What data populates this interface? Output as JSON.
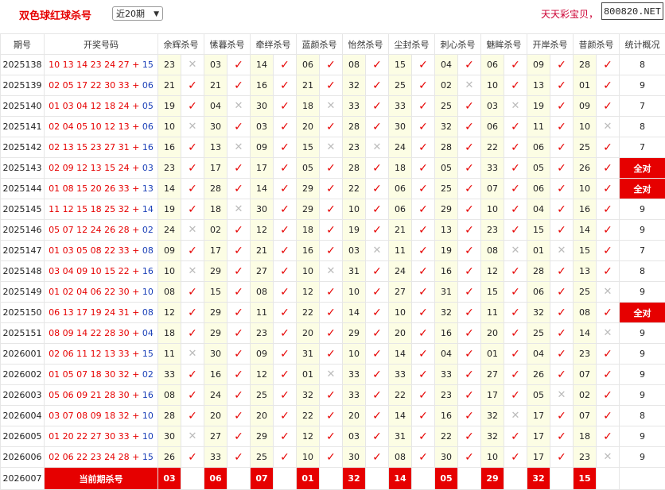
{
  "header": {
    "title": "双色球红球杀号",
    "period_select": "近20期",
    "promo": "天天彩宝贝，",
    "site_badge": "800820.NET"
  },
  "columns": [
    "期号",
    "开奖号码",
    "余辉杀号",
    "愫暮杀号",
    "牵绊杀号",
    "蓝颜杀号",
    "怡然杀号",
    "尘封杀号",
    "刺心杀号",
    "魅眸杀号",
    "开岸杀号",
    "昔颜杀号",
    "统计概况"
  ],
  "symbols": {
    "check": "✓",
    "cross": "✕"
  },
  "rows": [
    {
      "period": "2025138",
      "red": "10 13 14 23 24 27",
      "plus": "+",
      "blue": "15",
      "kills": [
        [
          "23",
          "x"
        ],
        [
          "03",
          "v"
        ],
        [
          "14",
          "v"
        ],
        [
          "06",
          "v"
        ],
        [
          "08",
          "v"
        ],
        [
          "15",
          "v"
        ],
        [
          "04",
          "v"
        ],
        [
          "06",
          "v"
        ],
        [
          "09",
          "v"
        ],
        [
          "28",
          "v"
        ]
      ],
      "stat": "8",
      "full": false
    },
    {
      "period": "2025139",
      "red": "02 05 17 22 30 33",
      "plus": "+",
      "blue": "06",
      "kills": [
        [
          "21",
          "v"
        ],
        [
          "21",
          "v"
        ],
        [
          "16",
          "v"
        ],
        [
          "21",
          "v"
        ],
        [
          "32",
          "v"
        ],
        [
          "25",
          "v"
        ],
        [
          "02",
          "x"
        ],
        [
          "10",
          "v"
        ],
        [
          "13",
          "v"
        ],
        [
          "01",
          "v"
        ]
      ],
      "stat": "9",
      "full": false
    },
    {
      "period": "2025140",
      "red": "01 03 04 12 18 24",
      "plus": "+",
      "blue": "05",
      "kills": [
        [
          "19",
          "v"
        ],
        [
          "04",
          "x"
        ],
        [
          "30",
          "v"
        ],
        [
          "18",
          "x"
        ],
        [
          "33",
          "v"
        ],
        [
          "33",
          "v"
        ],
        [
          "25",
          "v"
        ],
        [
          "03",
          "x"
        ],
        [
          "19",
          "v"
        ],
        [
          "09",
          "v"
        ]
      ],
      "stat": "7",
      "full": false
    },
    {
      "period": "2025141",
      "red": "02 04 05 10 12 13",
      "plus": "+",
      "blue": "06",
      "kills": [
        [
          "10",
          "x"
        ],
        [
          "30",
          "v"
        ],
        [
          "03",
          "v"
        ],
        [
          "20",
          "v"
        ],
        [
          "28",
          "v"
        ],
        [
          "30",
          "v"
        ],
        [
          "32",
          "v"
        ],
        [
          "06",
          "v"
        ],
        [
          "11",
          "v"
        ],
        [
          "10",
          "x"
        ]
      ],
      "stat": "8",
      "full": false
    },
    {
      "period": "2025142",
      "red": "02 13 15 23 27 31",
      "plus": "+",
      "blue": "16",
      "kills": [
        [
          "16",
          "v"
        ],
        [
          "13",
          "x"
        ],
        [
          "09",
          "v"
        ],
        [
          "15",
          "x"
        ],
        [
          "23",
          "x"
        ],
        [
          "24",
          "v"
        ],
        [
          "28",
          "v"
        ],
        [
          "22",
          "v"
        ],
        [
          "06",
          "v"
        ],
        [
          "25",
          "v"
        ]
      ],
      "stat": "7",
      "full": false
    },
    {
      "period": "2025143",
      "red": "02 09 12 13 15 24",
      "plus": "+",
      "blue": "03",
      "kills": [
        [
          "23",
          "v"
        ],
        [
          "17",
          "v"
        ],
        [
          "17",
          "v"
        ],
        [
          "05",
          "v"
        ],
        [
          "28",
          "v"
        ],
        [
          "18",
          "v"
        ],
        [
          "05",
          "v"
        ],
        [
          "33",
          "v"
        ],
        [
          "05",
          "v"
        ],
        [
          "26",
          "v"
        ]
      ],
      "stat": "全对",
      "full": true
    },
    {
      "period": "2025144",
      "red": "01 08 15 20 26 33",
      "plus": "+",
      "blue": "13",
      "kills": [
        [
          "14",
          "v"
        ],
        [
          "28",
          "v"
        ],
        [
          "14",
          "v"
        ],
        [
          "29",
          "v"
        ],
        [
          "22",
          "v"
        ],
        [
          "06",
          "v"
        ],
        [
          "25",
          "v"
        ],
        [
          "07",
          "v"
        ],
        [
          "06",
          "v"
        ],
        [
          "10",
          "v"
        ]
      ],
      "stat": "全对",
      "full": true
    },
    {
      "period": "2025145",
      "red": "11 12 15 18 25 32",
      "plus": "+",
      "blue": "14",
      "kills": [
        [
          "19",
          "v"
        ],
        [
          "18",
          "x"
        ],
        [
          "30",
          "v"
        ],
        [
          "29",
          "v"
        ],
        [
          "10",
          "v"
        ],
        [
          "06",
          "v"
        ],
        [
          "29",
          "v"
        ],
        [
          "10",
          "v"
        ],
        [
          "04",
          "v"
        ],
        [
          "16",
          "v"
        ]
      ],
      "stat": "9",
      "full": false
    },
    {
      "period": "2025146",
      "red": "05 07 12 24 26 28",
      "plus": "+",
      "blue": "02",
      "kills": [
        [
          "24",
          "x"
        ],
        [
          "02",
          "v"
        ],
        [
          "12",
          "v"
        ],
        [
          "18",
          "v"
        ],
        [
          "19",
          "v"
        ],
        [
          "21",
          "v"
        ],
        [
          "13",
          "v"
        ],
        [
          "23",
          "v"
        ],
        [
          "15",
          "v"
        ],
        [
          "14",
          "v"
        ]
      ],
      "stat": "9",
      "full": false
    },
    {
      "period": "2025147",
      "red": "01 03 05 08 22 33",
      "plus": "+",
      "blue": "08",
      "kills": [
        [
          "09",
          "v"
        ],
        [
          "17",
          "v"
        ],
        [
          "21",
          "v"
        ],
        [
          "16",
          "v"
        ],
        [
          "03",
          "x"
        ],
        [
          "11",
          "v"
        ],
        [
          "19",
          "v"
        ],
        [
          "08",
          "x"
        ],
        [
          "01",
          "x"
        ],
        [
          "15",
          "v"
        ]
      ],
      "stat": "7",
      "full": false
    },
    {
      "period": "2025148",
      "red": "03 04 09 10 15 22",
      "plus": "+",
      "blue": "16",
      "kills": [
        [
          "10",
          "x"
        ],
        [
          "29",
          "v"
        ],
        [
          "27",
          "v"
        ],
        [
          "10",
          "x"
        ],
        [
          "31",
          "v"
        ],
        [
          "24",
          "v"
        ],
        [
          "16",
          "v"
        ],
        [
          "12",
          "v"
        ],
        [
          "28",
          "v"
        ],
        [
          "13",
          "v"
        ]
      ],
      "stat": "8",
      "full": false
    },
    {
      "period": "2025149",
      "red": "01 02 04 06 22 30",
      "plus": "+",
      "blue": "10",
      "kills": [
        [
          "08",
          "v"
        ],
        [
          "15",
          "v"
        ],
        [
          "08",
          "v"
        ],
        [
          "12",
          "v"
        ],
        [
          "10",
          "v"
        ],
        [
          "27",
          "v"
        ],
        [
          "31",
          "v"
        ],
        [
          "15",
          "v"
        ],
        [
          "06",
          "v"
        ],
        [
          "25",
          "x"
        ]
      ],
      "stat": "9",
      "full": false
    },
    {
      "period": "2025150",
      "red": "06 13 17 19 24 31",
      "plus": "+",
      "blue": "08",
      "kills": [
        [
          "12",
          "v"
        ],
        [
          "29",
          "v"
        ],
        [
          "11",
          "v"
        ],
        [
          "22",
          "v"
        ],
        [
          "14",
          "v"
        ],
        [
          "10",
          "v"
        ],
        [
          "32",
          "v"
        ],
        [
          "11",
          "v"
        ],
        [
          "32",
          "v"
        ],
        [
          "08",
          "v"
        ]
      ],
      "stat": "全对",
      "full": true
    },
    {
      "period": "2025151",
      "red": "08 09 14 22 28 30",
      "plus": "+",
      "blue": "04",
      "kills": [
        [
          "18",
          "v"
        ],
        [
          "29",
          "v"
        ],
        [
          "23",
          "v"
        ],
        [
          "20",
          "v"
        ],
        [
          "29",
          "v"
        ],
        [
          "20",
          "v"
        ],
        [
          "16",
          "v"
        ],
        [
          "20",
          "v"
        ],
        [
          "25",
          "v"
        ],
        [
          "14",
          "x"
        ]
      ],
      "stat": "9",
      "full": false
    },
    {
      "period": "2026001",
      "red": "02 06 11 12 13 33",
      "plus": "+",
      "blue": "15",
      "kills": [
        [
          "11",
          "x"
        ],
        [
          "30",
          "v"
        ],
        [
          "09",
          "v"
        ],
        [
          "31",
          "v"
        ],
        [
          "10",
          "v"
        ],
        [
          "14",
          "v"
        ],
        [
          "04",
          "v"
        ],
        [
          "01",
          "v"
        ],
        [
          "04",
          "v"
        ],
        [
          "23",
          "v"
        ]
      ],
      "stat": "9",
      "full": false
    },
    {
      "period": "2026002",
      "red": "01 05 07 18 30 32",
      "plus": "+",
      "blue": "02",
      "kills": [
        [
          "33",
          "v"
        ],
        [
          "16",
          "v"
        ],
        [
          "12",
          "v"
        ],
        [
          "01",
          "x"
        ],
        [
          "33",
          "v"
        ],
        [
          "33",
          "v"
        ],
        [
          "33",
          "v"
        ],
        [
          "27",
          "v"
        ],
        [
          "26",
          "v"
        ],
        [
          "07",
          "v"
        ]
      ],
      "stat": "9",
      "full": false
    },
    {
      "period": "2026003",
      "red": "05 06 09 21 28 30",
      "plus": "+",
      "blue": "16",
      "kills": [
        [
          "08",
          "v"
        ],
        [
          "24",
          "v"
        ],
        [
          "25",
          "v"
        ],
        [
          "32",
          "v"
        ],
        [
          "33",
          "v"
        ],
        [
          "22",
          "v"
        ],
        [
          "23",
          "v"
        ],
        [
          "17",
          "v"
        ],
        [
          "05",
          "x"
        ],
        [
          "02",
          "v"
        ]
      ],
      "stat": "9",
      "full": false
    },
    {
      "period": "2026004",
      "red": "03 07 08 09 18 32",
      "plus": "+",
      "blue": "10",
      "kills": [
        [
          "28",
          "v"
        ],
        [
          "20",
          "v"
        ],
        [
          "20",
          "v"
        ],
        [
          "22",
          "v"
        ],
        [
          "20",
          "v"
        ],
        [
          "14",
          "v"
        ],
        [
          "16",
          "v"
        ],
        [
          "32",
          "x"
        ],
        [
          "17",
          "v"
        ],
        [
          "07",
          "v"
        ]
      ],
      "stat": "8",
      "full": false
    },
    {
      "period": "2026005",
      "red": "01 20 22 27 30 33",
      "plus": "+",
      "blue": "10",
      "kills": [
        [
          "30",
          "x"
        ],
        [
          "27",
          "v"
        ],
        [
          "29",
          "v"
        ],
        [
          "12",
          "v"
        ],
        [
          "03",
          "v"
        ],
        [
          "31",
          "v"
        ],
        [
          "22",
          "v"
        ],
        [
          "32",
          "v"
        ],
        [
          "17",
          "v"
        ],
        [
          "18",
          "v"
        ]
      ],
      "stat": "9",
      "full": false
    },
    {
      "period": "2026006",
      "red": "02 06 22 23 24 28",
      "plus": "+",
      "blue": "15",
      "kills": [
        [
          "26",
          "v"
        ],
        [
          "33",
          "v"
        ],
        [
          "25",
          "v"
        ],
        [
          "10",
          "v"
        ],
        [
          "30",
          "v"
        ],
        [
          "08",
          "v"
        ],
        [
          "30",
          "v"
        ],
        [
          "10",
          "v"
        ],
        [
          "17",
          "v"
        ],
        [
          "23",
          "x"
        ]
      ],
      "stat": "9",
      "full": false
    }
  ],
  "current": {
    "period": "2026007",
    "label": "当前期杀号",
    "kills": [
      "03",
      "06",
      "07",
      "01",
      "32",
      "14",
      "05",
      "29",
      "32",
      "15"
    ]
  }
}
